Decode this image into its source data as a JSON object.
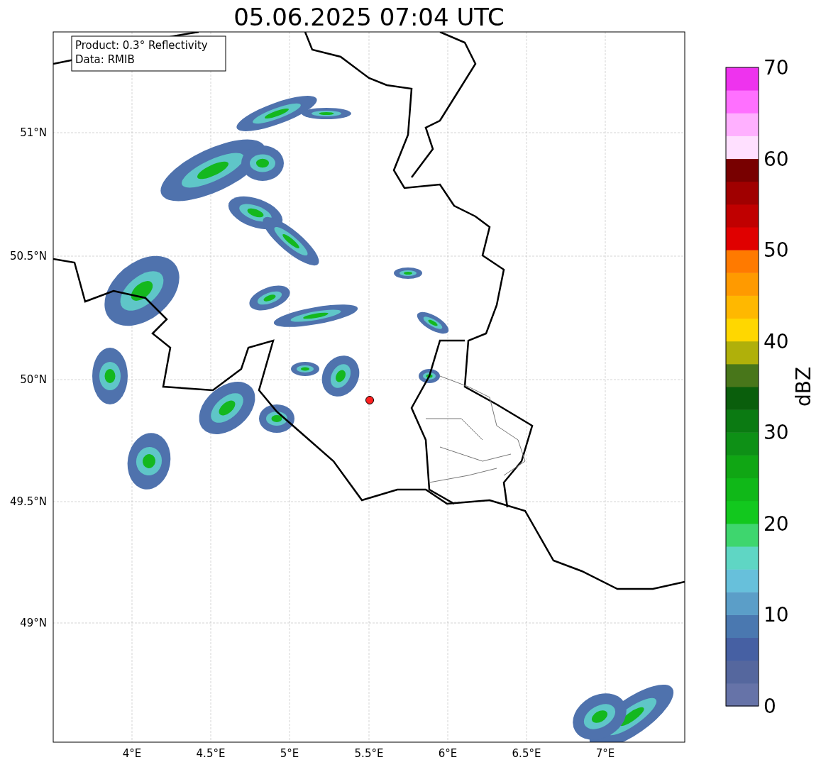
{
  "title": "05.06.2025 07:04 UTC",
  "info_box": [
    "Product: 0.3° Reflectivity",
    "Data: RMIB"
  ],
  "x_ticks": [
    "4°E",
    "4.5°E",
    "5°E",
    "5.5°E",
    "6°E",
    "6.5°E",
    "7°E"
  ],
  "y_ticks": [
    "51°N",
    "50.5°N",
    "50°N",
    "49.5°N",
    "49°N"
  ],
  "colorbar": {
    "label": "dBZ",
    "ticks": [
      "70",
      "60",
      "50",
      "40",
      "30",
      "20",
      "10",
      "0"
    ],
    "segments": [
      {
        "color": "#6673a8"
      },
      {
        "color": "#55679e"
      },
      {
        "color": "#4660a3"
      },
      {
        "color": "#4a78b0"
      },
      {
        "color": "#5b9ec8"
      },
      {
        "color": "#67c0db"
      },
      {
        "color": "#5fd6c4"
      },
      {
        "color": "#3ed66e"
      },
      {
        "color": "#12c81e"
      },
      {
        "color": "#10b818"
      },
      {
        "color": "#10a614"
      },
      {
        "color": "#0e9016"
      },
      {
        "color": "#0b7a12"
      },
      {
        "color": "#0a5e0c"
      },
      {
        "color": "#48761a"
      },
      {
        "color": "#b0b00a"
      },
      {
        "color": "#ffd700"
      },
      {
        "color": "#ffb800"
      },
      {
        "color": "#ff9a00"
      },
      {
        "color": "#ff7a00"
      },
      {
        "color": "#e00000"
      },
      {
        "color": "#c00000"
      },
      {
        "color": "#a00000"
      },
      {
        "color": "#780000"
      },
      {
        "color": "#ffe0ff"
      },
      {
        "color": "#ffb0ff"
      },
      {
        "color": "#ff70ff"
      },
      {
        "color": "#ee33ee"
      }
    ]
  }
}
